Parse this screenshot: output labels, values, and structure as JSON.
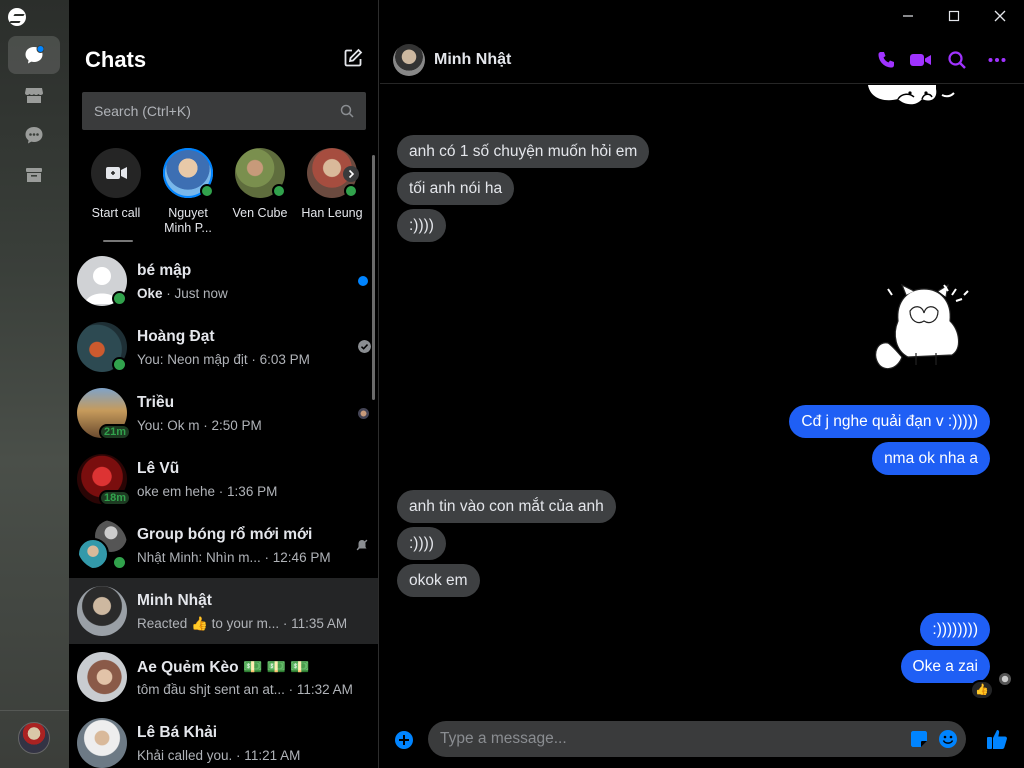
{
  "window": {
    "minimize": "—",
    "maximize": "☐",
    "close": "✕"
  },
  "sidebar": {
    "title": "Chats"
  },
  "search": {
    "placeholder": "Search (Ctrl+K)"
  },
  "stories": [
    {
      "label": "Start call"
    },
    {
      "label": "Nguyet Minh P..."
    },
    {
      "label": "Ven Cube"
    },
    {
      "label": "Han Leung"
    }
  ],
  "chats": [
    {
      "name": "bé mập",
      "preview_bold": "Oke",
      "preview": " · Just now"
    },
    {
      "name": "Hoàng Đạt",
      "preview": "You: Neon mập địt · 6:03 PM"
    },
    {
      "name": "Triều",
      "badge": "21m",
      "preview": "You: Ok m · 2:50 PM"
    },
    {
      "name": "Lê Vũ",
      "badge": "18m",
      "preview": "oke em hehe · 1:36 PM"
    },
    {
      "name": "Group bóng rổ mới mới",
      "preview": "Nhật Minh: Nhìn m... · 12:46 PM"
    },
    {
      "name": "Minh Nhật",
      "preview": "Reacted 👍 to your m... · 11:35 AM"
    },
    {
      "name": "Ae Quẻm Kèo 💵 💵 💵",
      "preview": "tôm đầu shjt sent an at... · 11:32 AM"
    },
    {
      "name": "Lê Bá Khải",
      "preview": "Khải called you. · 11:21 AM"
    }
  ],
  "conversation": {
    "name": "Minh Nhật",
    "messages": [
      {
        "side": "in",
        "text": "anh có 1 số chuyện muốn hỏi em"
      },
      {
        "side": "in",
        "text": "tối anh nói ha"
      },
      {
        "side": "in",
        "text": ":))))"
      },
      {
        "side": "out",
        "text": "Cđ j nghe quải đạn v :)))))"
      },
      {
        "side": "out",
        "text": "nma ok nha a"
      },
      {
        "side": "in",
        "text": "anh tin vào con mắt của anh"
      },
      {
        "side": "in",
        "text": ":))))"
      },
      {
        "side": "in",
        "text": "okok em"
      },
      {
        "side": "out",
        "text": ":))))))))"
      },
      {
        "side": "out",
        "text": "Oke a zai"
      }
    ],
    "reaction": "👍"
  },
  "composer": {
    "placeholder": "Type a message..."
  },
  "colors": {
    "accent": "#a033ff",
    "blue": "#0084ff",
    "online": "#31a24c"
  }
}
